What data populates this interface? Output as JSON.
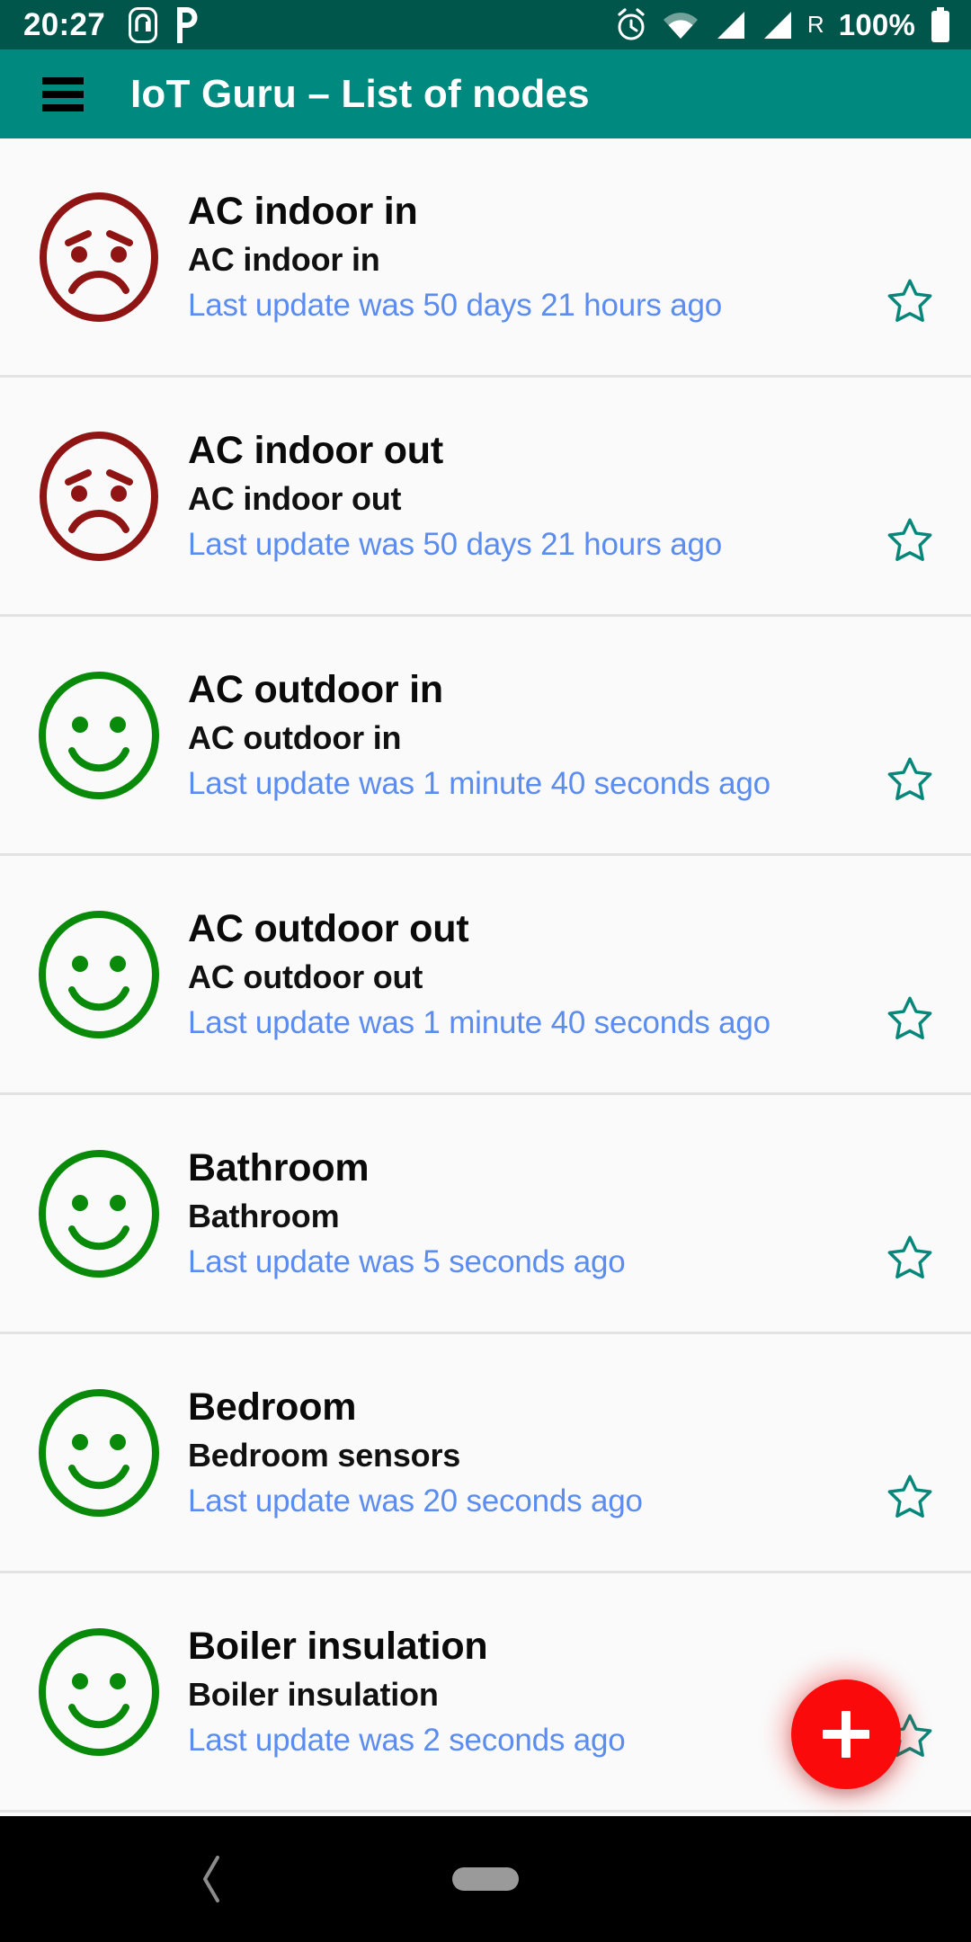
{
  "statusbar": {
    "clock": "20:27",
    "battery_percent": "100%",
    "roaming": "R",
    "icons": [
      "mi-app-icon",
      "parking-p-icon",
      "alarm-icon",
      "wifi-icon",
      "signal-icon",
      "signal-icon",
      "battery-icon"
    ]
  },
  "appbar": {
    "menu_icon": "hamburger-icon",
    "title": "IoT Guru – List of nodes"
  },
  "list": {
    "items": [
      {
        "status": "sad",
        "title": "AC indoor in",
        "subtitle": "AC indoor in",
        "update": "Last update was 50 days 21 hours ago",
        "favorite": false
      },
      {
        "status": "sad",
        "title": "AC indoor out",
        "subtitle": "AC indoor out",
        "update": "Last update was 50 days 21 hours ago",
        "favorite": false
      },
      {
        "status": "happy",
        "title": "AC outdoor in",
        "subtitle": "AC outdoor in",
        "update": "Last update was 1 minute 40 seconds ago",
        "favorite": false
      },
      {
        "status": "happy",
        "title": "AC outdoor out",
        "subtitle": "AC outdoor out",
        "update": "Last update was 1 minute 40 seconds ago",
        "favorite": false
      },
      {
        "status": "happy",
        "title": "Bathroom",
        "subtitle": "Bathroom",
        "update": "Last update was 5 seconds ago",
        "favorite": false
      },
      {
        "status": "happy",
        "title": "Bedroom",
        "subtitle": "Bedroom sensors",
        "update": "Last update was 20 seconds ago",
        "favorite": false
      },
      {
        "status": "happy",
        "title": "Boiler insulation",
        "subtitle": "Boiler insulation",
        "update": "Last update was 2 seconds ago",
        "favorite": false
      }
    ]
  },
  "fab": {
    "icon": "plus-icon",
    "label": "+"
  },
  "navbar": {
    "back_icon": "back-chevron-icon",
    "home_icon": "home-pill-icon"
  },
  "colors": {
    "statusbar_bg": "#00564a",
    "appbar_bg": "#00897f",
    "list_bg": "#fafafa",
    "divider": "#e2e2e2",
    "title_text": "#0a0a0a",
    "update_text": "#5b8cf0",
    "status_happy": "#0a8a0a",
    "status_sad": "#8f1414",
    "star": "#07877a",
    "fab_bg": "#fa0a0a",
    "navbar_bg": "#000000"
  }
}
